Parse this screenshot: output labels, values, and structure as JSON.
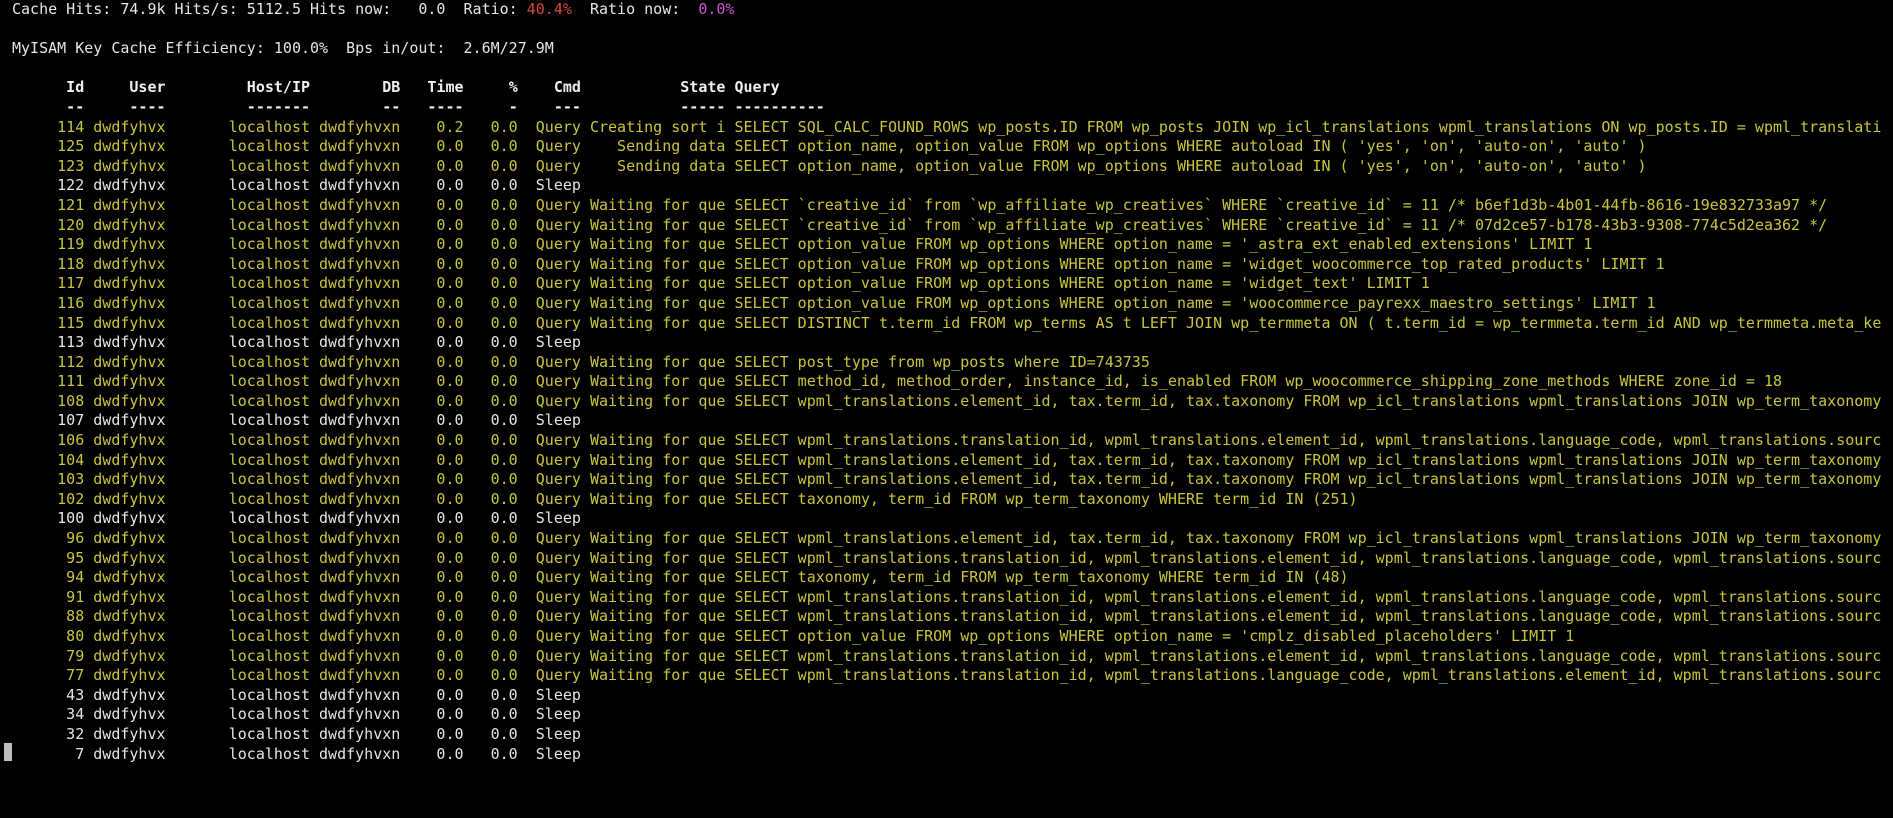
{
  "summary": {
    "cache_hits_label": "Cache Hits:",
    "cache_hits": "74.9k",
    "hits_s_label": "Hits/s:",
    "hits_s": "5112.5",
    "hits_now_label": "Hits now:",
    "hits_now": "0.0",
    "ratio_label": "Ratio:",
    "ratio": "40.4%",
    "ratio_now_label": "Ratio now:",
    "ratio_now": "0.0%",
    "myisam_label": "MyISAM Key Cache Efficiency:",
    "myisam": "100.0%",
    "bps_label": "Bps in/out:",
    "bps": "2.6M/27.9M"
  },
  "colors": {
    "query_row": "#c9c53d",
    "sleep_row": "#e6e6e6",
    "ratio": "#d9473a",
    "ratio_now": "#d44fd4"
  },
  "columns": {
    "id": "Id",
    "user": "User",
    "host": "Host/IP",
    "db": "DB",
    "time": "Time",
    "pct": "%",
    "cmd": "Cmd",
    "state": "State",
    "query": "Query",
    "id_rule": "--",
    "user_rule": "----",
    "host_rule": "-------",
    "db_rule": "--",
    "time_rule": "----",
    "pct_rule": "-",
    "cmd_rule": "---",
    "state_rule": "-----",
    "query_rule": "----------"
  },
  "rows": [
    {
      "id": "114",
      "user": "dwdfyhvx",
      "host": "localhost",
      "db": "dwdfyhvxn",
      "time": "0.2",
      "pct": "0.0",
      "cmd": "Query",
      "state": "Creating sort i",
      "query": "SELECT SQL_CALC_FOUND_ROWS wp_posts.ID FROM wp_posts JOIN wp_icl_translations wpml_translations ON wp_posts.ID = wpml_translati"
    },
    {
      "id": "125",
      "user": "dwdfyhvx",
      "host": "localhost",
      "db": "dwdfyhvxn",
      "time": "0.0",
      "pct": "0.0",
      "cmd": "Query",
      "state": "Sending data",
      "query": "SELECT option_name, option_value FROM wp_options WHERE autoload IN ( 'yes', 'on', 'auto-on', 'auto' )"
    },
    {
      "id": "123",
      "user": "dwdfyhvx",
      "host": "localhost",
      "db": "dwdfyhvxn",
      "time": "0.0",
      "pct": "0.0",
      "cmd": "Query",
      "state": "Sending data",
      "query": "SELECT option_name, option_value FROM wp_options WHERE autoload IN ( 'yes', 'on', 'auto-on', 'auto' )"
    },
    {
      "id": "122",
      "user": "dwdfyhvx",
      "host": "localhost",
      "db": "dwdfyhvxn",
      "time": "0.0",
      "pct": "0.0",
      "cmd": "Sleep",
      "state": "",
      "query": ""
    },
    {
      "id": "121",
      "user": "dwdfyhvx",
      "host": "localhost",
      "db": "dwdfyhvxn",
      "time": "0.0",
      "pct": "0.0",
      "cmd": "Query",
      "state": "Waiting for que",
      "query": "SELECT `creative_id` from `wp_affiliate_wp_creatives` WHERE `creative_id` = 11 /* b6ef1d3b-4b01-44fb-8616-19e832733a97 */"
    },
    {
      "id": "120",
      "user": "dwdfyhvx",
      "host": "localhost",
      "db": "dwdfyhvxn",
      "time": "0.0",
      "pct": "0.0",
      "cmd": "Query",
      "state": "Waiting for que",
      "query": "SELECT `creative_id` from `wp_affiliate_wp_creatives` WHERE `creative_id` = 11 /* 07d2ce57-b178-43b3-9308-774c5d2ea362 */"
    },
    {
      "id": "119",
      "user": "dwdfyhvx",
      "host": "localhost",
      "db": "dwdfyhvxn",
      "time": "0.0",
      "pct": "0.0",
      "cmd": "Query",
      "state": "Waiting for que",
      "query": "SELECT option_value FROM wp_options WHERE option_name = '_astra_ext_enabled_extensions' LIMIT 1"
    },
    {
      "id": "118",
      "user": "dwdfyhvx",
      "host": "localhost",
      "db": "dwdfyhvxn",
      "time": "0.0",
      "pct": "0.0",
      "cmd": "Query",
      "state": "Waiting for que",
      "query": "SELECT option_value FROM wp_options WHERE option_name = 'widget_woocommerce_top_rated_products' LIMIT 1"
    },
    {
      "id": "117",
      "user": "dwdfyhvx",
      "host": "localhost",
      "db": "dwdfyhvxn",
      "time": "0.0",
      "pct": "0.0",
      "cmd": "Query",
      "state": "Waiting for que",
      "query": "SELECT option_value FROM wp_options WHERE option_name = 'widget_text' LIMIT 1"
    },
    {
      "id": "116",
      "user": "dwdfyhvx",
      "host": "localhost",
      "db": "dwdfyhvxn",
      "time": "0.0",
      "pct": "0.0",
      "cmd": "Query",
      "state": "Waiting for que",
      "query": "SELECT option_value FROM wp_options WHERE option_name = 'woocommerce_payrexx_maestro_settings' LIMIT 1"
    },
    {
      "id": "115",
      "user": "dwdfyhvx",
      "host": "localhost",
      "db": "dwdfyhvxn",
      "time": "0.0",
      "pct": "0.0",
      "cmd": "Query",
      "state": "Waiting for que",
      "query": "SELECT DISTINCT t.term_id FROM wp_terms AS t LEFT JOIN wp_termmeta ON ( t.term_id = wp_termmeta.term_id AND wp_termmeta.meta_ke"
    },
    {
      "id": "113",
      "user": "dwdfyhvx",
      "host": "localhost",
      "db": "dwdfyhvxn",
      "time": "0.0",
      "pct": "0.0",
      "cmd": "Sleep",
      "state": "",
      "query": ""
    },
    {
      "id": "112",
      "user": "dwdfyhvx",
      "host": "localhost",
      "db": "dwdfyhvxn",
      "time": "0.0",
      "pct": "0.0",
      "cmd": "Query",
      "state": "Waiting for que",
      "query": "SELECT post_type from wp_posts where ID=743735"
    },
    {
      "id": "111",
      "user": "dwdfyhvx",
      "host": "localhost",
      "db": "dwdfyhvxn",
      "time": "0.0",
      "pct": "0.0",
      "cmd": "Query",
      "state": "Waiting for que",
      "query": "SELECT method_id, method_order, instance_id, is_enabled FROM wp_woocommerce_shipping_zone_methods WHERE zone_id = 18"
    },
    {
      "id": "108",
      "user": "dwdfyhvx",
      "host": "localhost",
      "db": "dwdfyhvxn",
      "time": "0.0",
      "pct": "0.0",
      "cmd": "Query",
      "state": "Waiting for que",
      "query": "SELECT wpml_translations.element_id, tax.term_id, tax.taxonomy FROM wp_icl_translations wpml_translations JOIN wp_term_taxonomy"
    },
    {
      "id": "107",
      "user": "dwdfyhvx",
      "host": "localhost",
      "db": "dwdfyhvxn",
      "time": "0.0",
      "pct": "0.0",
      "cmd": "Sleep",
      "state": "",
      "query": ""
    },
    {
      "id": "106",
      "user": "dwdfyhvx",
      "host": "localhost",
      "db": "dwdfyhvxn",
      "time": "0.0",
      "pct": "0.0",
      "cmd": "Query",
      "state": "Waiting for que",
      "query": "SELECT wpml_translations.translation_id, wpml_translations.element_id, wpml_translations.language_code, wpml_translations.sourc"
    },
    {
      "id": "104",
      "user": "dwdfyhvx",
      "host": "localhost",
      "db": "dwdfyhvxn",
      "time": "0.0",
      "pct": "0.0",
      "cmd": "Query",
      "state": "Waiting for que",
      "query": "SELECT wpml_translations.element_id, tax.term_id, tax.taxonomy FROM wp_icl_translations wpml_translations JOIN wp_term_taxonomy"
    },
    {
      "id": "103",
      "user": "dwdfyhvx",
      "host": "localhost",
      "db": "dwdfyhvxn",
      "time": "0.0",
      "pct": "0.0",
      "cmd": "Query",
      "state": "Waiting for que",
      "query": "SELECT wpml_translations.element_id, tax.term_id, tax.taxonomy FROM wp_icl_translations wpml_translations JOIN wp_term_taxonomy"
    },
    {
      "id": "102",
      "user": "dwdfyhvx",
      "host": "localhost",
      "db": "dwdfyhvxn",
      "time": "0.0",
      "pct": "0.0",
      "cmd": "Query",
      "state": "Waiting for que",
      "query": "SELECT taxonomy, term_id FROM wp_term_taxonomy WHERE term_id IN (251)"
    },
    {
      "id": "100",
      "user": "dwdfyhvx",
      "host": "localhost",
      "db": "dwdfyhvxn",
      "time": "0.0",
      "pct": "0.0",
      "cmd": "Sleep",
      "state": "",
      "query": ""
    },
    {
      "id": "96",
      "user": "dwdfyhvx",
      "host": "localhost",
      "db": "dwdfyhvxn",
      "time": "0.0",
      "pct": "0.0",
      "cmd": "Query",
      "state": "Waiting for que",
      "query": "SELECT wpml_translations.element_id, tax.term_id, tax.taxonomy FROM wp_icl_translations wpml_translations JOIN wp_term_taxonomy"
    },
    {
      "id": "95",
      "user": "dwdfyhvx",
      "host": "localhost",
      "db": "dwdfyhvxn",
      "time": "0.0",
      "pct": "0.0",
      "cmd": "Query",
      "state": "Waiting for que",
      "query": "SELECT wpml_translations.translation_id, wpml_translations.element_id, wpml_translations.language_code, wpml_translations.sourc"
    },
    {
      "id": "94",
      "user": "dwdfyhvx",
      "host": "localhost",
      "db": "dwdfyhvxn",
      "time": "0.0",
      "pct": "0.0",
      "cmd": "Query",
      "state": "Waiting for que",
      "query": "SELECT taxonomy, term_id FROM wp_term_taxonomy WHERE term_id IN (48)"
    },
    {
      "id": "91",
      "user": "dwdfyhvx",
      "host": "localhost",
      "db": "dwdfyhvxn",
      "time": "0.0",
      "pct": "0.0",
      "cmd": "Query",
      "state": "Waiting for que",
      "query": "SELECT wpml_translations.translation_id, wpml_translations.element_id, wpml_translations.language_code, wpml_translations.sourc"
    },
    {
      "id": "88",
      "user": "dwdfyhvx",
      "host": "localhost",
      "db": "dwdfyhvxn",
      "time": "0.0",
      "pct": "0.0",
      "cmd": "Query",
      "state": "Waiting for que",
      "query": "SELECT wpml_translations.translation_id, wpml_translations.element_id, wpml_translations.language_code, wpml_translations.sourc"
    },
    {
      "id": "80",
      "user": "dwdfyhvx",
      "host": "localhost",
      "db": "dwdfyhvxn",
      "time": "0.0",
      "pct": "0.0",
      "cmd": "Query",
      "state": "Waiting for que",
      "query": "SELECT option_value FROM wp_options WHERE option_name = 'cmplz_disabled_placeholders' LIMIT 1"
    },
    {
      "id": "79",
      "user": "dwdfyhvx",
      "host": "localhost",
      "db": "dwdfyhvxn",
      "time": "0.0",
      "pct": "0.0",
      "cmd": "Query",
      "state": "Waiting for que",
      "query": "SELECT wpml_translations.translation_id, wpml_translations.element_id, wpml_translations.language_code, wpml_translations.sourc"
    },
    {
      "id": "77",
      "user": "dwdfyhvx",
      "host": "localhost",
      "db": "dwdfyhvxn",
      "time": "0.0",
      "pct": "0.0",
      "cmd": "Query",
      "state": "Waiting for que",
      "query": "SELECT wpml_translations.translation_id, wpml_translations.language_code, wpml_translations.element_id, wpml_translations.sourc"
    },
    {
      "id": "43",
      "user": "dwdfyhvx",
      "host": "localhost",
      "db": "dwdfyhvxn",
      "time": "0.0",
      "pct": "0.0",
      "cmd": "Sleep",
      "state": "",
      "query": ""
    },
    {
      "id": "34",
      "user": "dwdfyhvx",
      "host": "localhost",
      "db": "dwdfyhvxn",
      "time": "0.0",
      "pct": "0.0",
      "cmd": "Sleep",
      "state": "",
      "query": ""
    },
    {
      "id": "32",
      "user": "dwdfyhvx",
      "host": "localhost",
      "db": "dwdfyhvxn",
      "time": "0.0",
      "pct": "0.0",
      "cmd": "Sleep",
      "state": "",
      "query": ""
    },
    {
      "id": "7",
      "user": "dwdfyhvx",
      "host": "localhost",
      "db": "dwdfyhvxn",
      "time": "0.0",
      "pct": "0.0",
      "cmd": "Sleep",
      "state": "",
      "query": ""
    }
  ]
}
